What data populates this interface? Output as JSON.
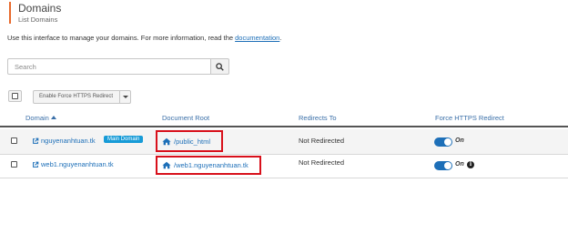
{
  "page": {
    "title": "Domains",
    "subtitle": "List Domains",
    "intro_text": "Use this interface to manage your domains. For more information, read the ",
    "intro_link": "documentation",
    "intro_end": ".",
    "accent_color": "#e8692c"
  },
  "search": {
    "placeholder": "Search",
    "value": "",
    "icon": "search-icon"
  },
  "bulk": {
    "label": "Enable Force HTTPS Redirect"
  },
  "table": {
    "columns": [
      "Domain",
      "Document Root",
      "Redirects To",
      "Force HTTPS Redirect"
    ],
    "sort_column": "Domain",
    "sort_direction": "ascending",
    "rows": [
      {
        "domain": "nguyenanhtuan.tk",
        "badge": "Main Domain",
        "document_root": "/public_html",
        "redirects_to": "Not Redirected",
        "force_https": "On",
        "force_https_enabled": true,
        "has_info_icon": false
      },
      {
        "domain": "web1.nguyenanhtuan.tk",
        "badge": "",
        "document_root": "/web1.nguyenanhtuan.tk",
        "redirects_to": "Not Redirected",
        "force_https": "On",
        "force_https_enabled": true,
        "has_info_icon": true
      }
    ]
  },
  "colors": {
    "link": "#1d6fb8",
    "badge": "#179bd7",
    "highlight_box": "#d8101b",
    "toggle_on": "#1d6fb8"
  }
}
